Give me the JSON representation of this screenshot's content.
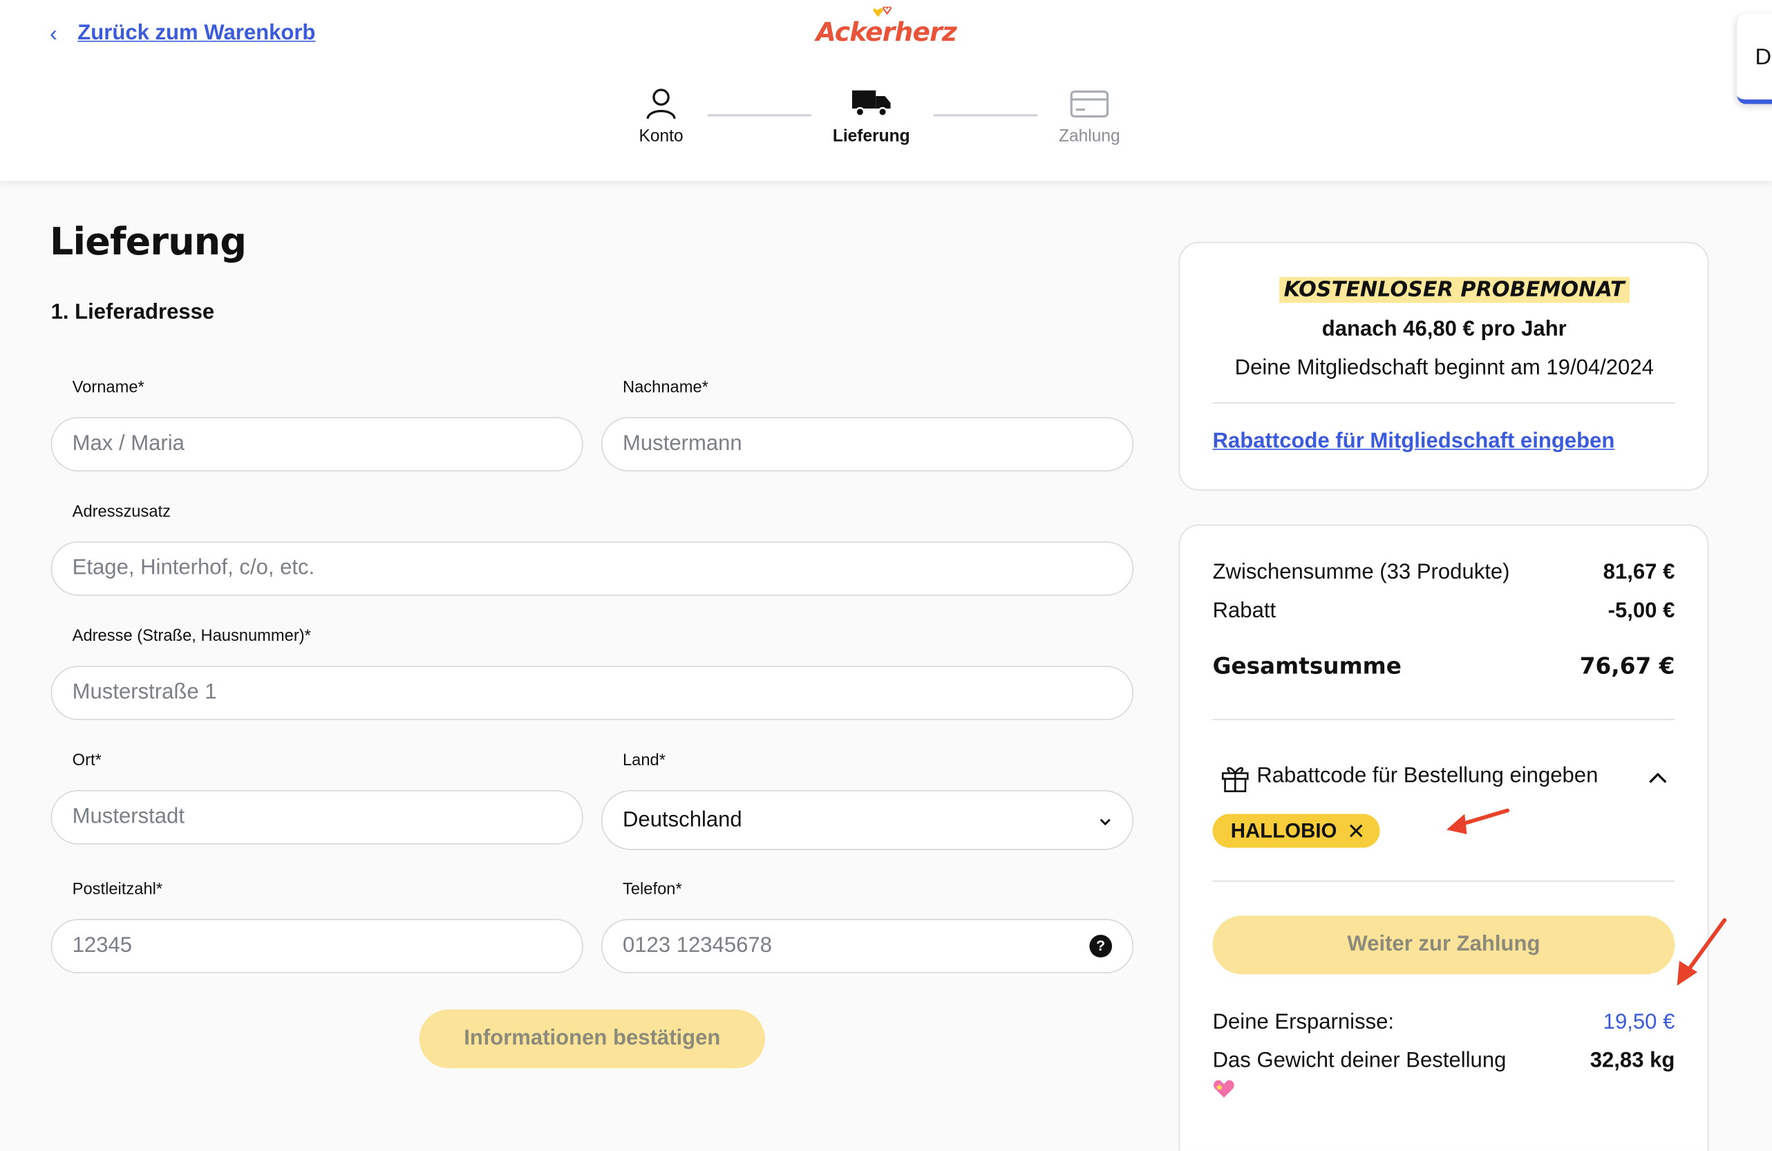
{
  "header": {
    "back_label": "Zurück zum Warenkorb",
    "logo_text": "Ackerherz",
    "side_tab_letter": "D",
    "steps": [
      {
        "label": "Konto",
        "icon": "user-icon",
        "state": "done"
      },
      {
        "label": "Lieferung",
        "icon": "truck-icon",
        "state": "active"
      },
      {
        "label": "Zahlung",
        "icon": "credit-card-icon",
        "state": "upcoming"
      }
    ]
  },
  "form": {
    "title": "Lieferung",
    "section": "1. Lieferadresse",
    "vorname": {
      "label": "Vorname*",
      "placeholder": "Max / Maria"
    },
    "nachname": {
      "label": "Nachname*",
      "placeholder": "Mustermann"
    },
    "adresszusatz": {
      "label": "Adresszusatz",
      "placeholder": "Etage, Hinterhof, c/o, etc."
    },
    "adresse": {
      "label": "Adresse (Straße, Hausnummer)*",
      "placeholder": "Musterstraße 1"
    },
    "ort": {
      "label": "Ort*",
      "placeholder": "Musterstadt"
    },
    "land": {
      "label": "Land*",
      "value": "Deutschland"
    },
    "plz": {
      "label": "Postleitzahl*",
      "placeholder": "12345"
    },
    "telefon": {
      "label": "Telefon*",
      "placeholder": "0123 12345678",
      "help": "?"
    },
    "confirm_label": "Informationen bestätigen"
  },
  "membership": {
    "headline": "KOSTENLOSER PROBEMONAT",
    "price_line": "danach 46,80 € pro Jahr",
    "start_line": "Deine Mitgliedschaft beginnt am 19/04/2024",
    "coupon_link": "Rabattcode für Mitgliedschaft eingeben"
  },
  "summary": {
    "subtotal_label": "Zwischensumme (33 Produkte)",
    "subtotal_value": "81,67 €",
    "discount_label": "Rabatt",
    "discount_value": "-5,00 €",
    "total_label": "Gesamtsumme",
    "total_value": "76,67 €",
    "coupon_toggle": "Rabattcode für Bestellung eingeben",
    "coupon_code": "HALLOBIO",
    "pay_label": "Weiter zur Zahlung",
    "savings_label": "Deine Ersparnisse:",
    "savings_value": "19,50 €",
    "weight_label": "Das Gewicht deiner Bestellung",
    "weight_value": "32,83 kg"
  },
  "colors": {
    "accent_blue": "#3b5bdb",
    "button_yellow": "#fbe49a",
    "chip_yellow": "#f7cd3c",
    "annotation_red": "#e8432a",
    "logo_orange": "#e8543a"
  }
}
